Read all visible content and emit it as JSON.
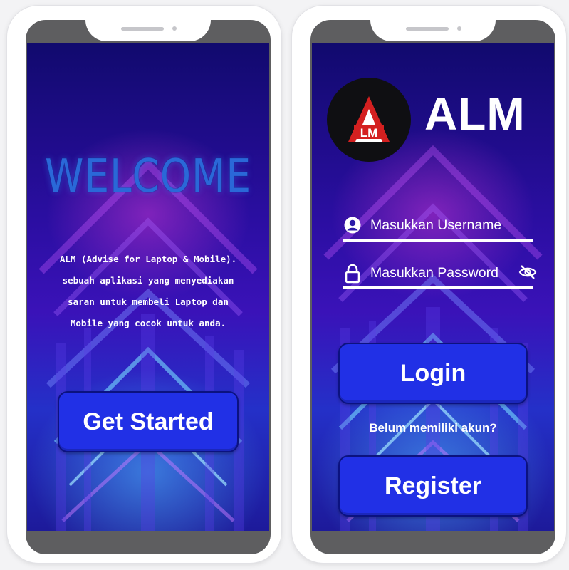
{
  "welcome_screen": {
    "title": "WELCOME",
    "description_lines": [
      "ALM (Advise for Laptop & Mobile).",
      "sebuah aplikasi yang menyediakan",
      "saran untuk membeli Laptop dan",
      "Mobile yang cocok untuk anda."
    ],
    "get_started_label": "Get Started"
  },
  "login_screen": {
    "logo_letters": "ALM",
    "app_name": "ALM",
    "username_placeholder": "Masukkan Username",
    "password_placeholder": "Masukkan Password",
    "no_account_text": "Belum memiliki akun?",
    "login_label": "Login",
    "register_label": "Register"
  },
  "icons": {
    "username": "user-circle-icon",
    "password": "lock-icon",
    "visibility": "eye-off-icon"
  },
  "colors": {
    "button_blue": "#2130e6",
    "welcome_title_blue": "#2a68d8",
    "background_navy": "#110a6e",
    "logo_red": "#d42020"
  }
}
